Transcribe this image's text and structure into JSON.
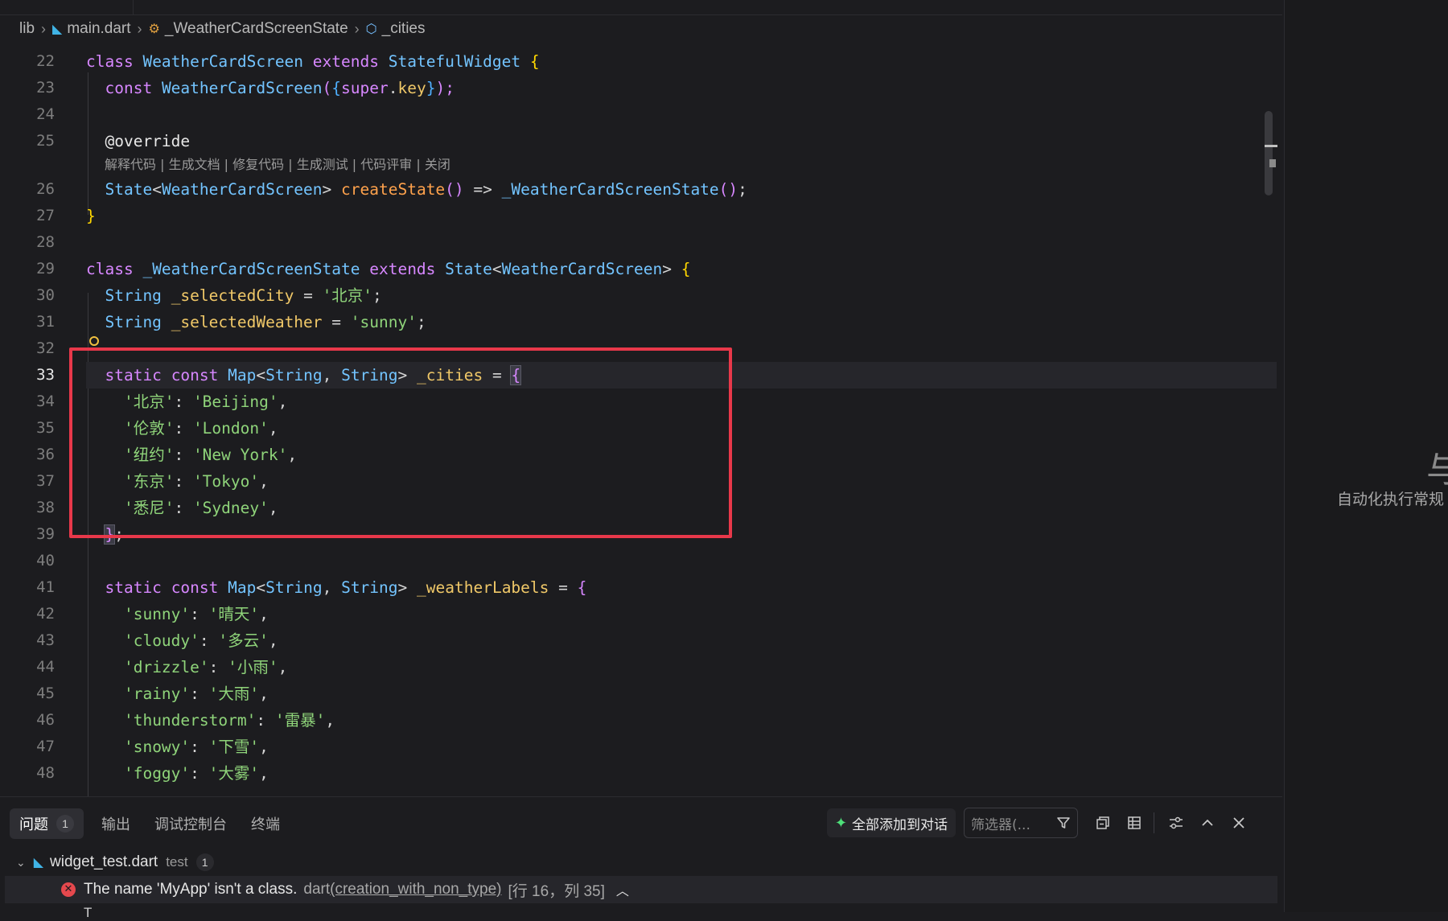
{
  "breadcrumb": [
    "lib",
    "main.dart",
    "_WeatherCardScreenState",
    "_cities"
  ],
  "codelens": "解释代码 | 生成文档 | 修复代码 | 生成测试 | 代码评审 | 关闭",
  "line_numbers": [
    "22",
    "23",
    "24",
    "25",
    "26",
    "27",
    "28",
    "29",
    "30",
    "31",
    "32",
    "33",
    "34",
    "35",
    "36",
    "37",
    "38",
    "39",
    "40",
    "41",
    "42",
    "43",
    "44",
    "45",
    "46",
    "47",
    "48"
  ],
  "active_line": "33",
  "code": {
    "l22": [
      "class",
      "WeatherCardScreen",
      "extends",
      "StatefulWidget",
      "{"
    ],
    "l23": [
      "const",
      "WeatherCardScreen",
      "(",
      "{",
      "super",
      ".",
      "key",
      "}",
      ");"
    ],
    "l25": "@override",
    "l26": [
      "State",
      "<",
      "WeatherCardScreen",
      ">",
      "createState",
      "()",
      "=>",
      "_WeatherCardScreenState",
      "()",
      ";"
    ],
    "l27": "}",
    "l29": [
      "class",
      "_WeatherCardScreenState",
      "extends",
      "State",
      "<",
      "WeatherCardScreen",
      ">",
      "{"
    ],
    "l30": [
      "String",
      "_selectedCity",
      "=",
      "'北京'",
      ";"
    ],
    "l31": [
      "String",
      "_selectedWeather",
      "=",
      "'sunny'",
      ";"
    ],
    "l33": [
      "static",
      "const",
      "Map",
      "<",
      "String",
      ",",
      "String",
      ">",
      "_cities",
      "=",
      "{"
    ],
    "cities": [
      {
        "key": "'北京'",
        "value": "'Beijing'"
      },
      {
        "key": "'伦敦'",
        "value": "'London'"
      },
      {
        "key": "'纽约'",
        "value": "'New York'"
      },
      {
        "key": "'东京'",
        "value": "'Tokyo'"
      },
      {
        "key": "'悉尼'",
        "value": "'Sydney'"
      }
    ],
    "l39": [
      "}",
      ";"
    ],
    "l41": [
      "static",
      "const",
      "Map",
      "<",
      "String",
      ",",
      "String",
      ">",
      "_weatherLabels",
      "=",
      "{"
    ],
    "weather": [
      {
        "key": "'sunny'",
        "value": "'晴天'"
      },
      {
        "key": "'cloudy'",
        "value": "'多云'"
      },
      {
        "key": "'drizzle'",
        "value": "'小雨'"
      },
      {
        "key": "'rainy'",
        "value": "'大雨'"
      },
      {
        "key": "'thunderstorm'",
        "value": "'雷暴'"
      },
      {
        "key": "'snowy'",
        "value": "'下雪'"
      },
      {
        "key": "'foggy'",
        "value": "'大雾'"
      }
    ]
  },
  "right_pane": {
    "glyph": "与",
    "hint": "自动化执行常规"
  },
  "panel": {
    "tabs": [
      {
        "label": "问题",
        "count": "1"
      },
      {
        "label": "输出"
      },
      {
        "label": "调试控制台"
      },
      {
        "label": "终端"
      }
    ],
    "add_all_label": "全部添加到对话",
    "filter_placeholder": "筛选器(...",
    "file": {
      "name": "widget_test.dart",
      "path": "test",
      "count": "1"
    },
    "error": {
      "message": "The name 'MyApp' isn't a class.",
      "source": "dart",
      "code": "(creation_with_non_type)",
      "position": "[行 16，列 35]"
    },
    "next_line_fragment": "T"
  },
  "colors": {
    "keyword": "#d787ff",
    "type": "#73c4ff",
    "function": "#ffa24c",
    "string": "#8fd47a",
    "variable": "#f0c868",
    "highlight_box": "#e8384a",
    "error": "#e5484d"
  },
  "icons": [
    "dart-file-icon",
    "class-icon",
    "field-icon",
    "lightbulb-icon",
    "sparkle-icon",
    "filter-icon",
    "collapse-all-icon",
    "table-icon",
    "settings-icon",
    "chevron-up-icon",
    "close-icon",
    "error-icon"
  ]
}
